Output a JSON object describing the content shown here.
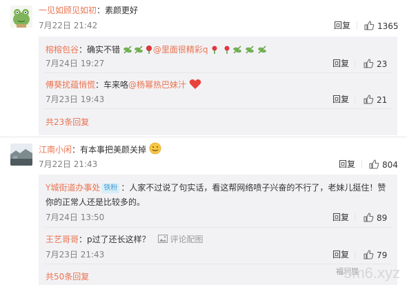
{
  "comments": [
    {
      "user": "一见如顾见如初",
      "text": "素颜更好",
      "time": "7月22日 21:42",
      "reply_label": "回复",
      "likes": "1365",
      "replies": [
        {
          "user": "榕榕包谷",
          "text": "确实不错",
          "mention": "@里面很精彩q",
          "time": "7月24日 19:27",
          "reply_label": "回复",
          "likes": "23"
        },
        {
          "user": "傅葵扰蕴悄慌",
          "text": "车来咯",
          "mention": "@杨幂热巴妹汁",
          "time": "7月23日 19:43",
          "reply_label": "回复",
          "likes": "21"
        }
      ],
      "more_label": "共23条回复"
    },
    {
      "user": "江南小闲",
      "text": "有本事把美颜关掉",
      "time": "7月22日 21:43",
      "reply_label": "回复",
      "likes": "804",
      "replies": [
        {
          "user": "Y城街道办事处",
          "badge": "铁粉",
          "text": "人家不过说了句实话，看这帮网络喷子兴奋的不行了，老妹儿挺住！赞",
          "text2": "你的正常人还是比较多的。",
          "time": "7月24日 13:50",
          "reply_label": "回复",
          "likes": "89"
        },
        {
          "user": "王艺哥哥",
          "text": "p过了还长这样？",
          "pic_label": "评论配图",
          "time": "7月23日 21:43",
          "reply_label": "回复",
          "likes": "79"
        }
      ],
      "more_label": "共50条回复"
    }
  ],
  "watermark": "5m6.xyz",
  "watermark_small": "福利猫",
  "colors": {
    "accent": "#eb7350",
    "reply_bg": "#f2f2f5",
    "meta": "#808080"
  }
}
